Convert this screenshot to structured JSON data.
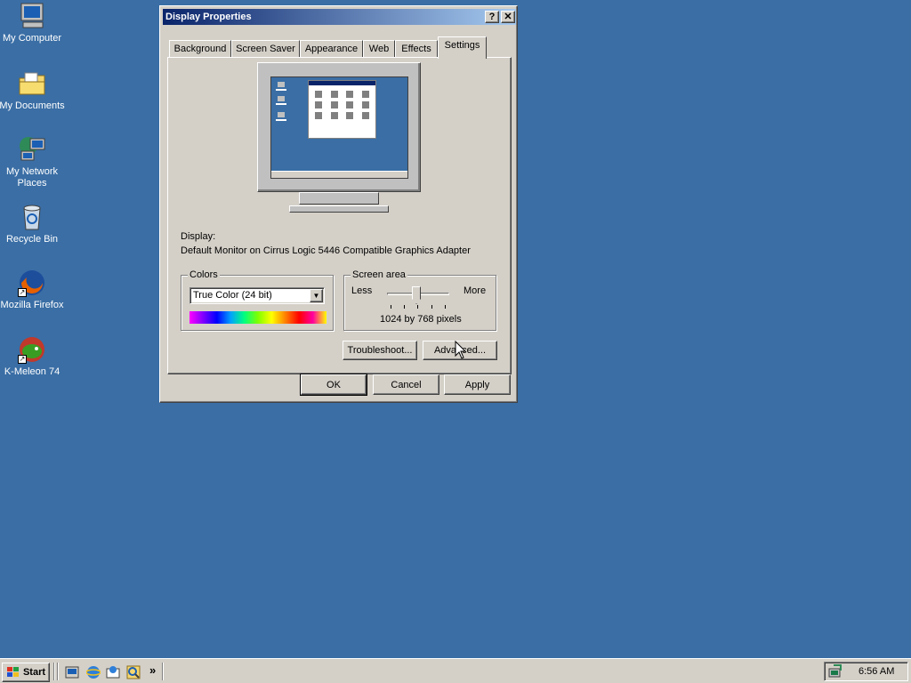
{
  "desktop": {
    "icons": [
      {
        "label": "My Computer"
      },
      {
        "label": "My Documents"
      },
      {
        "label": "My Network Places"
      },
      {
        "label": "Recycle Bin"
      },
      {
        "label": "Mozilla Firefox"
      },
      {
        "label": "K-Meleon 74"
      }
    ],
    "background_color": "#3a6ea5"
  },
  "dialog": {
    "title": "Display Properties",
    "help_button": "?",
    "close_button": "✕",
    "tabs": [
      {
        "label": "Background"
      },
      {
        "label": "Screen Saver"
      },
      {
        "label": "Appearance"
      },
      {
        "label": "Web"
      },
      {
        "label": "Effects"
      },
      {
        "label": "Settings",
        "active": true
      }
    ],
    "display_label": "Display:",
    "display_value": "Default Monitor on Cirrus Logic 5446 Compatible Graphics Adapter",
    "colors": {
      "title": "Colors",
      "selected": "True Color (24 bit)"
    },
    "screen_area": {
      "title": "Screen area",
      "less": "Less",
      "more": "More",
      "value": "1024 by 768 pixels"
    },
    "troubleshoot_button": "Troubleshoot...",
    "advanced_button": "Advanced...",
    "ok_button": "OK",
    "cancel_button": "Cancel",
    "apply_button": "Apply"
  },
  "taskbar": {
    "start_label": "Start",
    "chevron": "»",
    "clock": "6:56 AM"
  }
}
